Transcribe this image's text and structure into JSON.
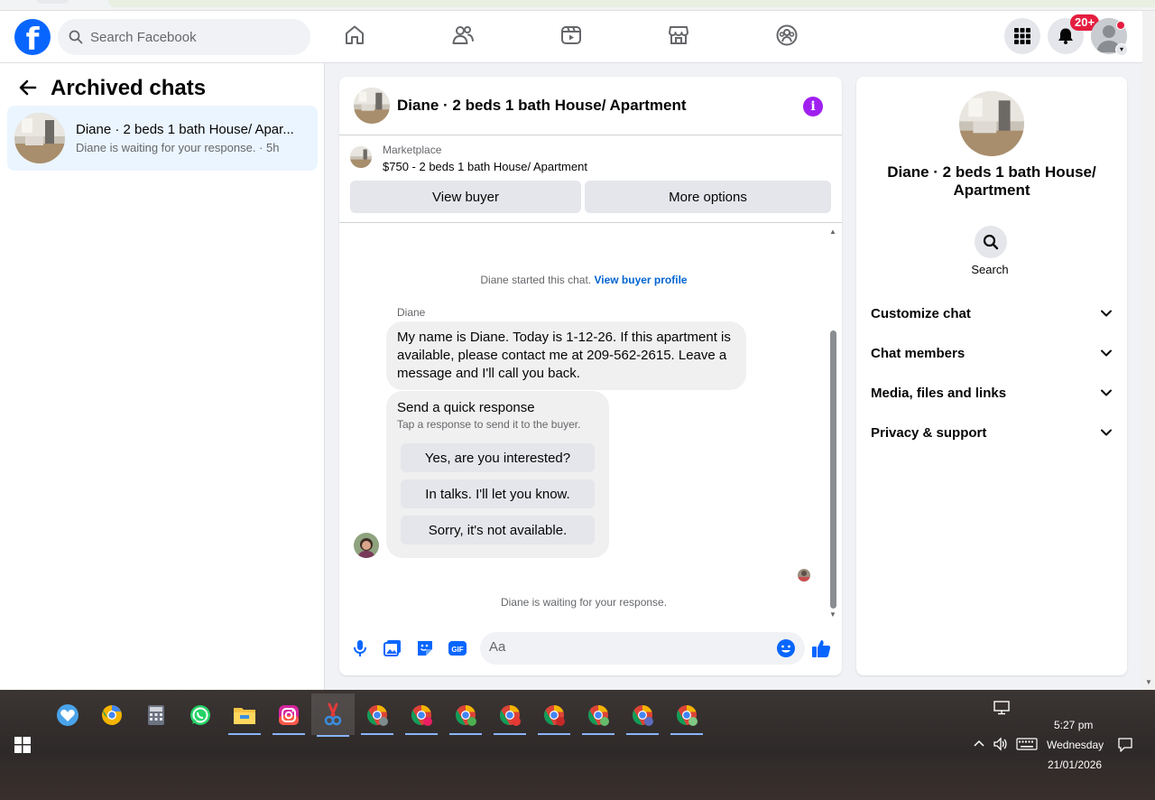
{
  "header": {
    "search_placeholder": "Search Facebook",
    "notification_badge": "20+",
    "nav": [
      "home-icon",
      "friends-icon",
      "video-icon",
      "marketplace-icon",
      "groups-icon"
    ]
  },
  "left": {
    "title": "Archived chats",
    "chat": {
      "name": "Diane · 2 beds 1 bath House/ Apar...",
      "subtitle": "Diane is waiting for your response. · 5h"
    }
  },
  "conversation": {
    "title": "Diane · 2 beds 1 bath House/ Apartment",
    "marketplace_label": "Marketplace",
    "listing": "$750 - 2 beds 1 bath House/ Apartment",
    "view_buyer": "View buyer",
    "more_options": "More options",
    "started_text": "Diane started this chat.",
    "view_buyer_profile": "View buyer profile",
    "sender": "Diane",
    "message": "My name is Diane. Today is 1-12-26.  If this apartment is available, please contact me at 209-562-2615.  Leave a message and I'll call you back.",
    "quick_title": "Send a quick response",
    "quick_subtitle": "Tap a response to send it to the buyer.",
    "quick_responses": [
      "Yes, are you interested?",
      "In talks. I'll let you know.",
      "Sorry, it's not available."
    ],
    "waiting": "Diane is waiting for your response.",
    "composer_placeholder": "Aa"
  },
  "details": {
    "name": "Diane · 2 beds 1 bath House/ Apartment",
    "search_label": "Search",
    "sections": [
      "Customize chat",
      "Chat members",
      "Media, files and links",
      "Privacy & support"
    ]
  },
  "taskbar": {
    "time": "5:27 pm",
    "day": "Wednesday",
    "date": "21/01/2026"
  },
  "colors": {
    "facebook_blue": "#0866ff",
    "link_blue": "#0064d1",
    "selected_chat_bg": "#ebf5ff",
    "info_purple": "#a020f0",
    "badge_red": "#e41e3f"
  }
}
